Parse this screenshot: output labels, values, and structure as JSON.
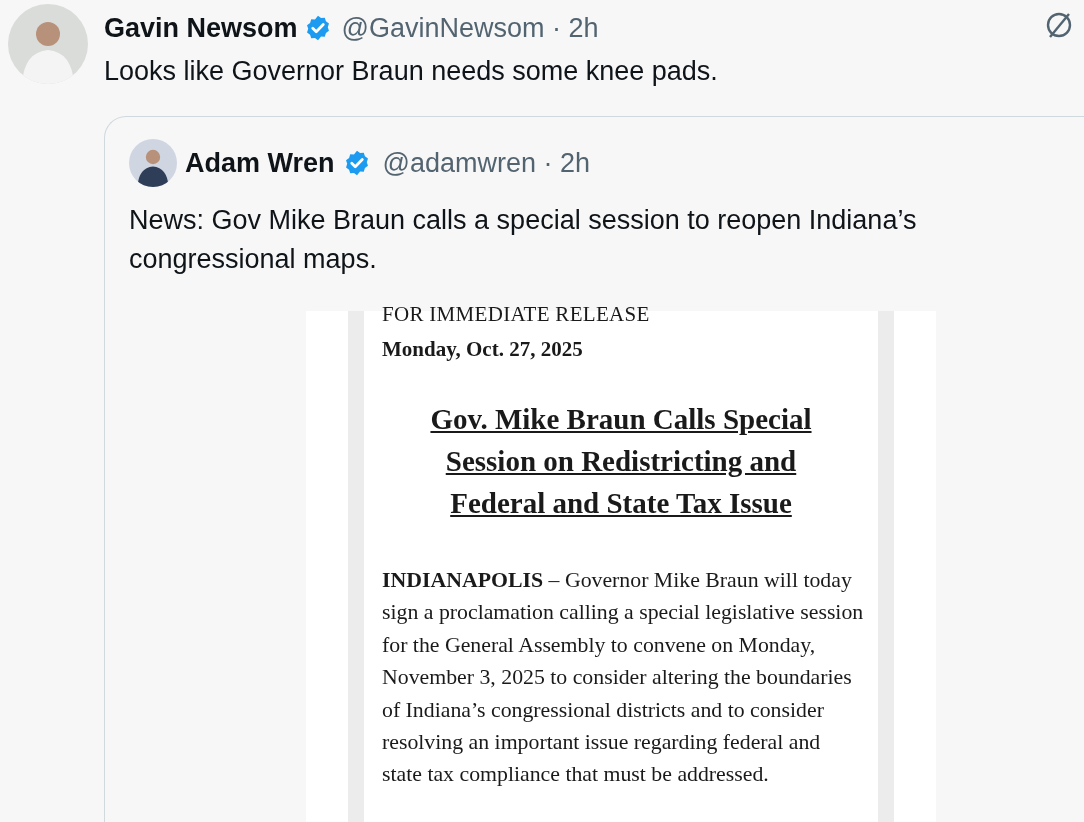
{
  "post": {
    "author": "Gavin Newsom",
    "verified": true,
    "handle": "@GavinNewsom · 2h",
    "text": "Looks like Governor Braun needs some knee pads.",
    "quoted_post": {
      "author": "Adam Wren",
      "verified": true,
      "handle": "@adamwren · 2h",
      "text": "News: Gov Mike Braun calls a special session to reopen Indiana’s congressional maps.",
      "document": {
        "release_label": "FOR IMMEDIATE RELEASE",
        "date": "Monday, Oct. 27, 2025",
        "headline": [
          "Gov. Mike Braun Calls Special",
          "Session on Redistricting and",
          "Federal and State Tax Issue"
        ],
        "body": "**INDIANAPOLIS** – Governor Mike Braun will today sign a proclamation calling a special legislative session for the General Assembly to convene on Monday, November 3, 2025 to consider altering the boundaries of Indiana’s congressional districts and to consider resolving an important issue regarding federal and state tax compliance that must be addressed."
      }
    }
  }
}
